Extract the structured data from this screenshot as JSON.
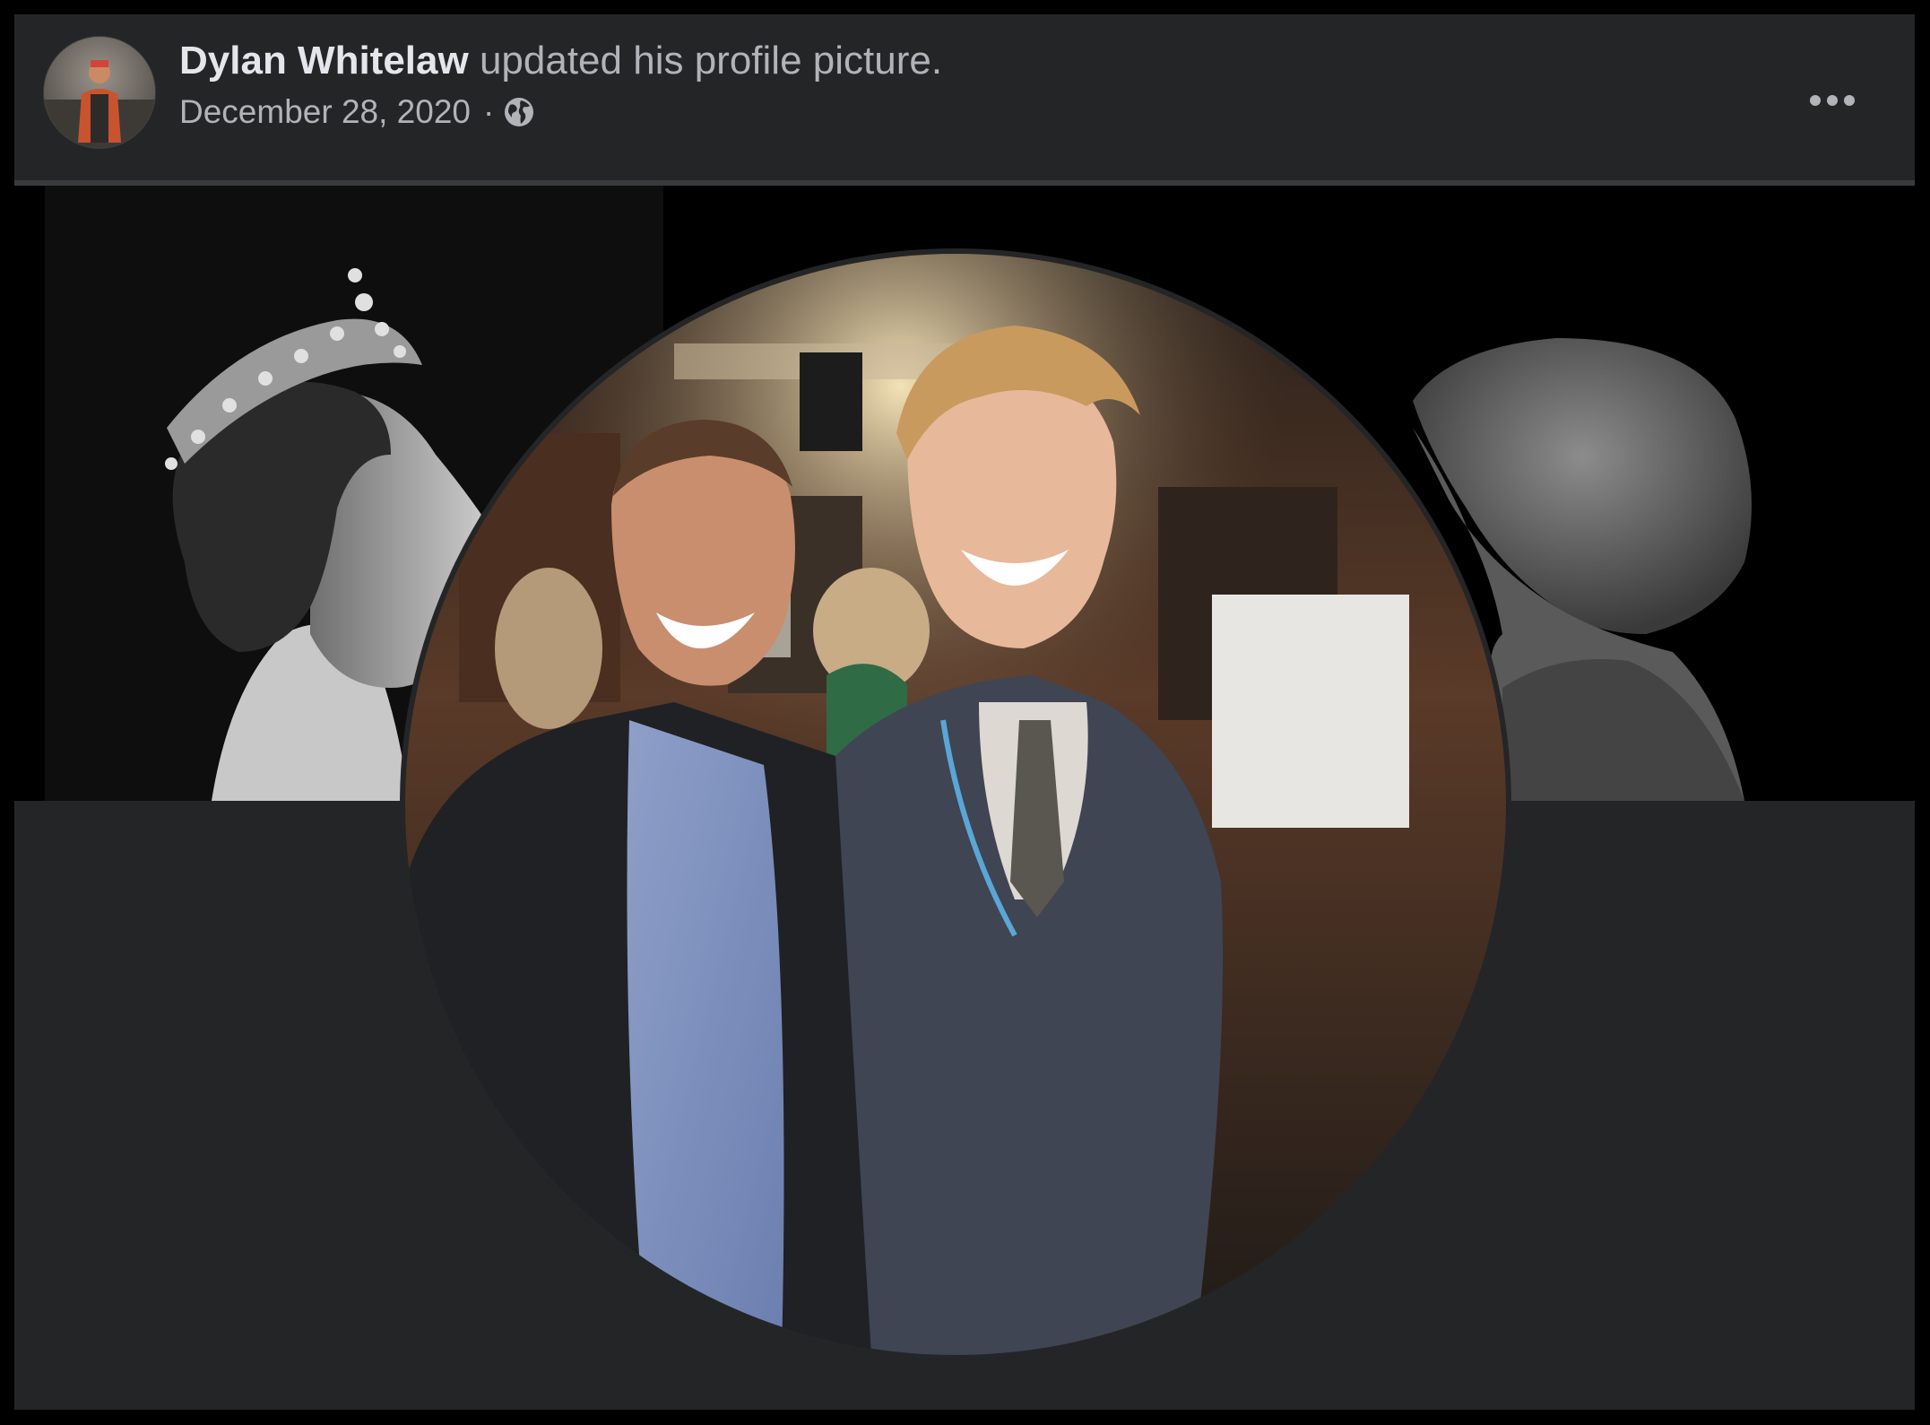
{
  "post": {
    "author_name": "Dylan Whitelaw",
    "action_text": "updated his profile picture.",
    "date": "December 28, 2020",
    "separator": "·",
    "privacy_icon": "globe-icon",
    "more_icon": "more-options-icon"
  },
  "colors": {
    "card_background": "#242526",
    "primary_text": "#e4e6eb",
    "secondary_text": "#b0b3b8"
  }
}
